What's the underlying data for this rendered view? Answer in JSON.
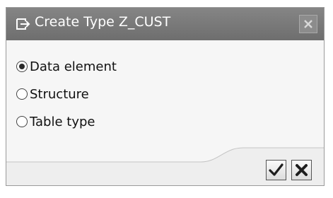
{
  "dialog": {
    "title": "Create Type Z_CUST",
    "title_icon": "create-document-icon",
    "close_icon": "close-icon"
  },
  "options": [
    {
      "label": "Data element",
      "selected": true
    },
    {
      "label": "Structure",
      "selected": false
    },
    {
      "label": "Table type",
      "selected": false
    }
  ],
  "footer": {
    "confirm_icon": "checkmark-icon",
    "cancel_icon": "cancel-x-icon"
  }
}
